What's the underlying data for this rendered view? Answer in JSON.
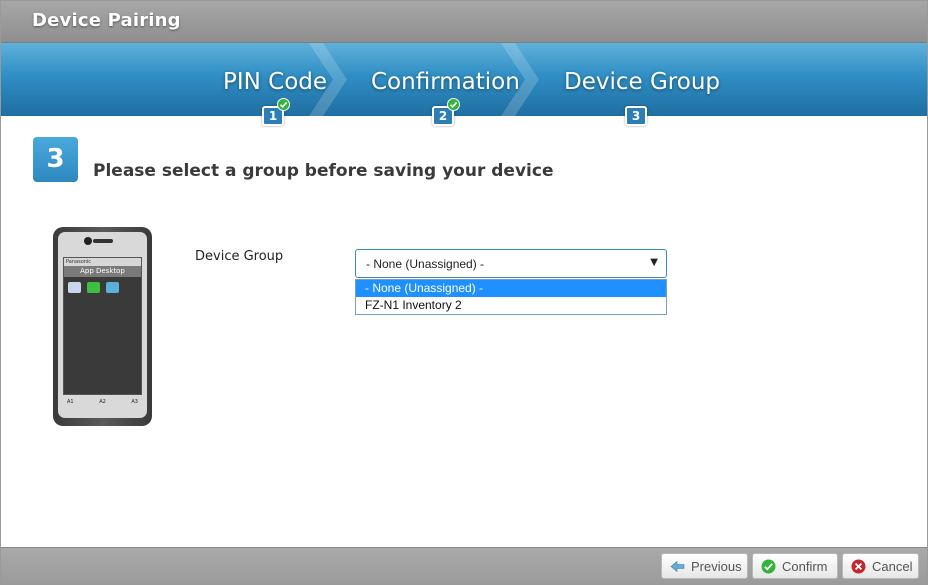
{
  "window": {
    "title": "Device Pairing"
  },
  "wizard": {
    "steps": [
      {
        "label": "PIN Code",
        "number": "1",
        "completed": true
      },
      {
        "label": "Confirmation",
        "number": "2",
        "completed": true
      },
      {
        "label": "Device Group",
        "number": "3",
        "completed": false
      }
    ],
    "current_step": "3"
  },
  "content": {
    "instruction": "Please select a group before saving your device",
    "device_image": {
      "brand": "Panasonic",
      "screen_title": "App Desktop",
      "apps": [
        "About",
        "Battery Level",
        "Smart SIM"
      ],
      "keys": [
        "A1",
        "A2",
        "A3"
      ]
    },
    "device_group_label": "Device Group",
    "device_group_select": {
      "value": "- None (Unassigned) -",
      "options": [
        "- None (Unassigned) -",
        "FZ-N1 Inventory 2"
      ],
      "highlighted": "- None (Unassigned) -"
    }
  },
  "footer": {
    "previous_label": "Previous",
    "confirm_label": "Confirm",
    "cancel_label": "Cancel"
  },
  "colors": {
    "accent": "#2d88c0",
    "check": "#34b33a",
    "highlight": "#1e90ff",
    "cancel": "#c0282d"
  }
}
